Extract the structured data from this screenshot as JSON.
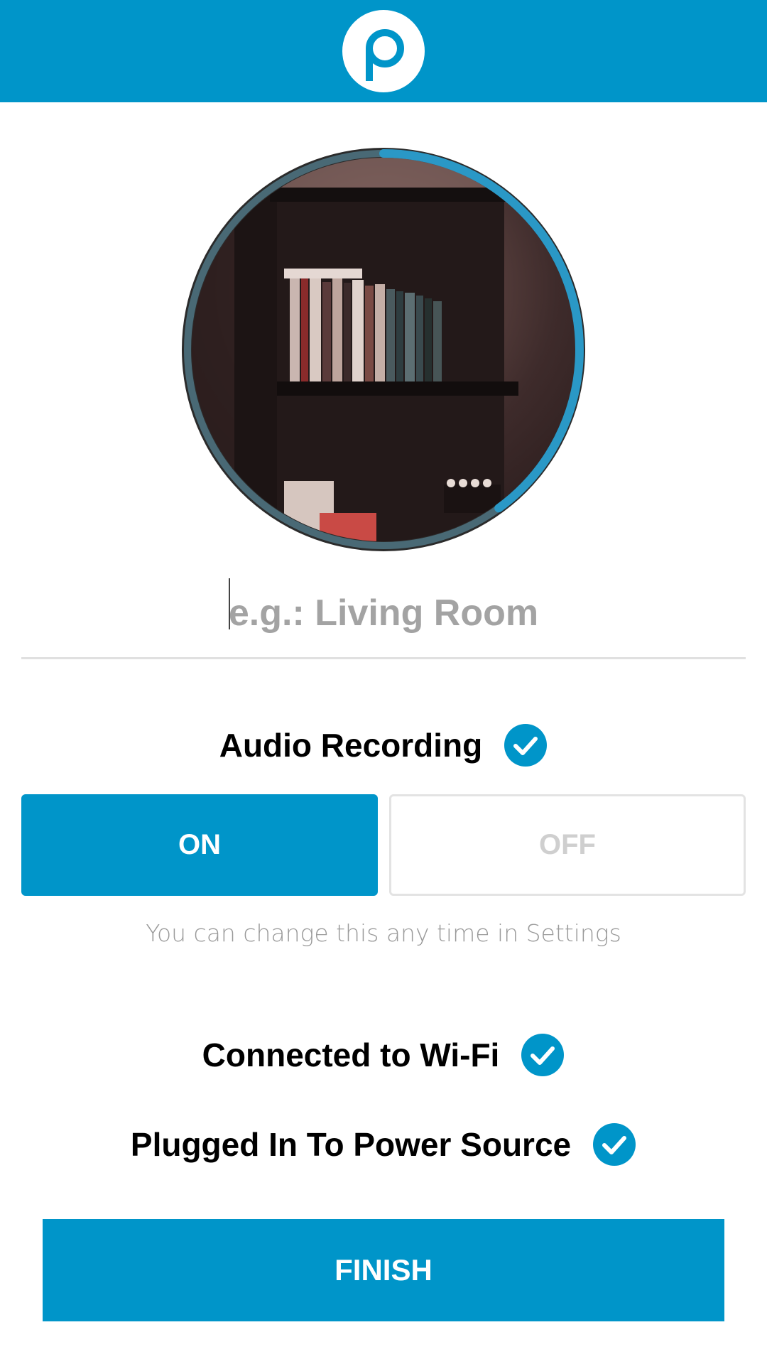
{
  "app": {
    "logo_icon": "p-logo-icon",
    "brand_color": "#0095c9"
  },
  "camera_preview": {
    "icon": "camera-preview-thumbnail",
    "progress": 0.4
  },
  "camera_name": {
    "value": "",
    "placeholder": "e.g.: Living Room"
  },
  "audio": {
    "label": "Audio Recording",
    "status_icon": "check-circle-icon",
    "on_label": "ON",
    "off_label": "OFF",
    "selected": "ON",
    "hint": "You can change this any time in Settings"
  },
  "status": [
    {
      "label": "Connected to Wi-Fi",
      "icon": "check-circle-icon"
    },
    {
      "label": "Plugged In To Power Source",
      "icon": "check-circle-icon"
    }
  ],
  "finish_label": "FINISH"
}
